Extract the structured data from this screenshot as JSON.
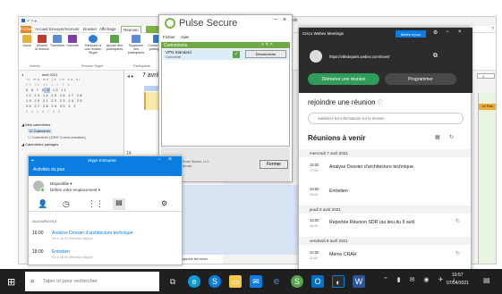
{
  "outlook": {
    "title_fragment": "yllbook",
    "tabs": [
      "Fichier",
      "Accueil",
      "Envoyer/recevoir",
      "Dossier",
      "Affichage",
      "Réunion"
    ],
    "ribbon": [
      {
        "label": "Ouvrir",
        "color": "#e8b23a"
      },
      {
        "label": "Annuler la réunion",
        "color": "#c0392b"
      },
      {
        "label": "Transférer",
        "color": "#5b8ad6"
      },
      {
        "label": "Onenote",
        "color": "#7b3fa6"
      },
      {
        "label": "Participer à une réunion Skype",
        "color": "#2d7dd2"
      },
      {
        "label": "Ajouter des participants",
        "color": "#5aa34a"
      },
      {
        "label": "Supprimer des participants",
        "color": "#5b8ad6"
      },
      {
        "label": "Contacter les participants",
        "color": "#2d7dd2"
      }
    ],
    "ribbon_groups": [
      "Actions",
      "Réunion Skype",
      "Participants"
    ],
    "minical": {
      "month": "avril 2021",
      "days_header": "lu ma me je ve sa di",
      "rows": [
        "29 30 31 1 2 3 4",
        "5 6 7 8 9 10 11",
        "12 13 14 15 16 17 18",
        "19 20 21 22 23 24 25",
        "26 27 28 29 30 1 2",
        "3 4 5 6 7 8 9"
      ]
    },
    "folders": {
      "mes_header": "Mes calendriers",
      "mes_items": [
        "Calendrier",
        "Calendrier (GRH Communication)"
      ],
      "partages_header": "Calendriers partagés"
    },
    "day_header": "7 avril 2021",
    "day_label": "Calendrier",
    "times": [
      "14",
      "15"
    ],
    "status_fragment": "Rappels terminés",
    "right_pane_label": "en Plan"
  },
  "pulse": {
    "title": "Pulse Secure",
    "menu": [
      "Fichier",
      "Aide"
    ],
    "section": "Connexions",
    "connection_name": "VPN Standard",
    "connection_status": "Connecté",
    "disconnect_label": "Déconnecter",
    "copyright": "© 2010-2020 Pulse Secure, LLC",
    "rights": "Tous droits réservés",
    "close_label": "Fermer"
  },
  "skype": {
    "title": "Skype Entreprise",
    "subtitle": "Activités du jour",
    "status": "Disponible",
    "location": "Définir votre emplacement",
    "section": "AUJOURD'HUI",
    "meetings": [
      {
        "time": "16:00",
        "title": "Analyse Dossier d'architecture technique",
        "detail": "Fin à 16:00 (Réunion Skype)"
      },
      {
        "time": "18:00",
        "title": "Entretien",
        "detail": "Fin à 19:00 (Réunion Skype)"
      }
    ]
  },
  "webex": {
    "title": "Cisco Webex Meetings",
    "update_label": "Mettre à jour",
    "url": "https://villedeparis.webex.com/meet/",
    "start_label": "Démarrer une réunion",
    "schedule_label": "Programmer",
    "join_title": "rejoindre une réunion",
    "join_placeholder": "Saisissez les informations sur la réunion",
    "upcoming_title": "Réunions à venir",
    "groups": [
      {
        "date": "mercredi 7 avril 2021",
        "items": [
          {
            "start": "16:00",
            "end": "17:00",
            "title": "Analyse Dossier d'architecture technique"
          },
          {
            "start": "18:00",
            "end": "19:00",
            "title": "Entretien"
          }
        ]
      },
      {
        "date": "jeudi 8 avril 2021",
        "items": [
          {
            "start": "15:00",
            "end": "16:30",
            "title": "Reportée Réunion SDR (au lieu du 6 avril"
          }
        ]
      },
      {
        "date": "vendredi 9 avril 2021",
        "items": [
          {
            "start": "10:00",
            "end": "11:00",
            "title": "Mémo CRAH"
          }
        ]
      }
    ]
  },
  "taskbar": {
    "search_placeholder": "Taper ici pour rechercher",
    "time": "10:57",
    "date": "07/04/2021"
  }
}
